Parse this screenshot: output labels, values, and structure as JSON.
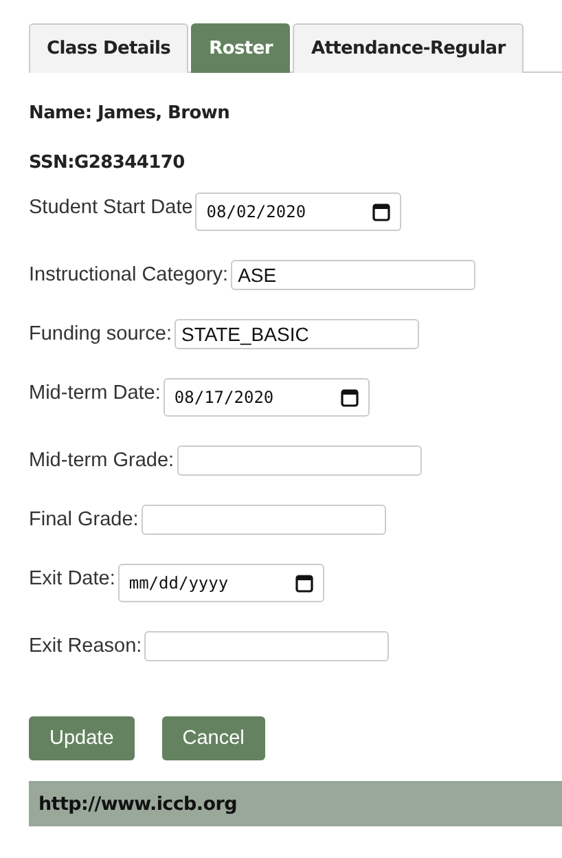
{
  "tabs": [
    {
      "label": "Class Details",
      "selected": false
    },
    {
      "label": "Roster",
      "selected": true
    },
    {
      "label": "Attendance-Regular",
      "selected": false
    }
  ],
  "student": {
    "name": "Name: James, Brown",
    "ssn": "SSN:G28344170"
  },
  "fields": [
    {
      "kind": "date",
      "label": "Student Start Date",
      "value": "08/02/2020"
    },
    {
      "kind": "text",
      "label": "Instructional Category:",
      "value": "ASE"
    },
    {
      "kind": "text",
      "label": "Funding source:",
      "value": "STATE_BASIC"
    },
    {
      "kind": "date",
      "label": "Mid-term Date:",
      "value": "08/17/2020"
    },
    {
      "kind": "text",
      "label": "Mid-term Grade:"
    },
    {
      "kind": "text",
      "label": "Final Grade:"
    },
    {
      "kind": "date",
      "label": "Exit Date:",
      "placeholder": "mm/dd/yyyy"
    },
    {
      "kind": "text",
      "label": "Exit Reason:"
    }
  ],
  "buttons": [
    "Update",
    "Cancel"
  ],
  "footer": {
    "link": "http://www.iccb.org"
  }
}
